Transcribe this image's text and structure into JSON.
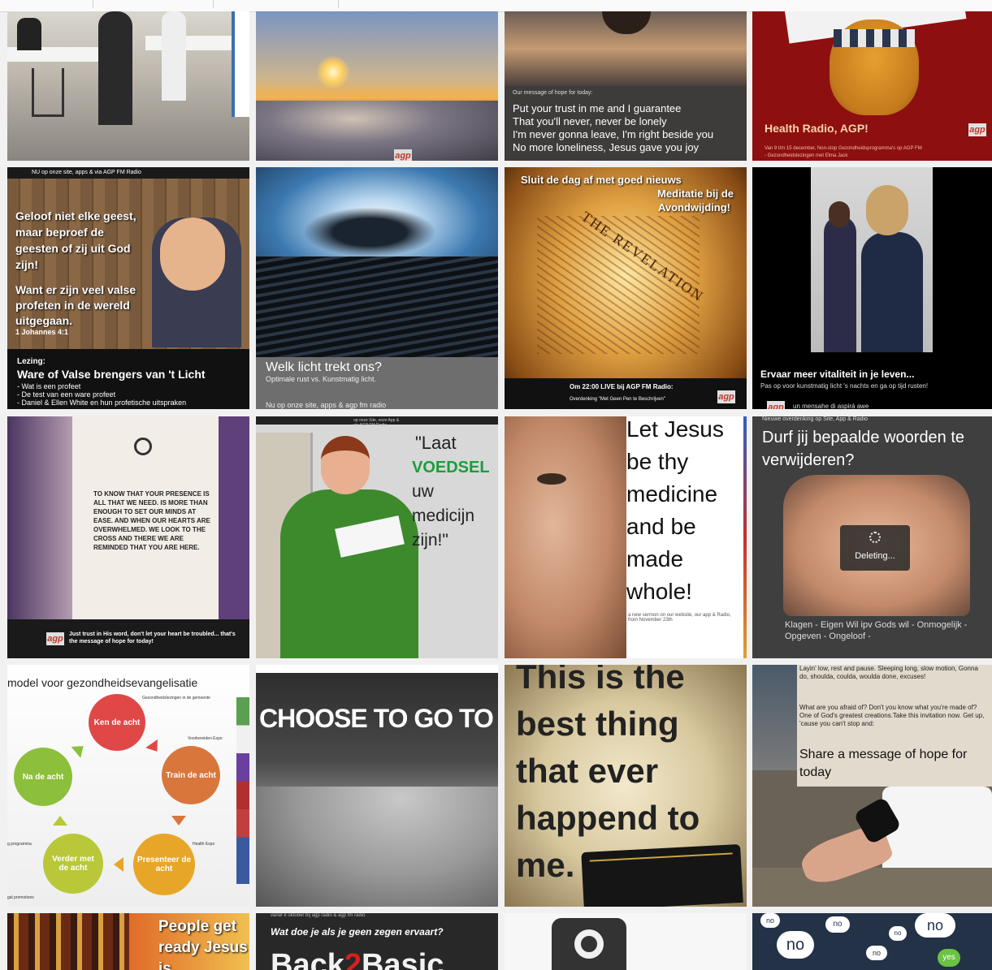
{
  "tiles": {
    "t4_caption": "Our message of hope for today:",
    "t4_lines": [
      "Put your trust in me and I guarantee",
      "That you'll never, never be lonely",
      "I'm never gonna leave, I'm right beside you",
      "No more loneliness, Jesus gave you joy"
    ],
    "t4_brand": "agp",
    "t5_title": "Health Radio, AGP!",
    "t5_sub": "Van 9 t/m 15 december, Non-stop Gezondheidsprogramma's op AGP FM",
    "t5_sub2": "- Gezondheidslezingen met Elma Jack",
    "t6_top": "NU op onze site, apps & via AGP FM Radio",
    "t6_quote": "Geloof niet elke geest, maar beproef de geesten of zij uit God zijn!",
    "t6_quote2": "Want er zijn veel valse profeten in de wereld uitgegaan.",
    "t6_ref": "1 Johannes 4:1",
    "t6_label": "Lezing:",
    "t6_title": "Ware of Valse brengers van 't Licht",
    "t6_b1": "- Wat is een profeet",
    "t6_b2": "- De test van een ware profeet",
    "t6_b3": "- Daniel & Ellen White en hun profetische uitspraken",
    "t7_title": "Welk licht trekt ons?",
    "t7_sub": "Optimale rust vs. Kunstmatig licht.",
    "t7_bottom": "Nu op onze site, apps & agp fm radio",
    "t8_line1": "Sluit de dag af met goed nieuws",
    "t8_line2": "Meditatie bij de",
    "t8_line3": "Avondwijding!",
    "t8_live": "Om 22:00 LIVE bij AGP FM Radio:",
    "t8_sub": "Overdenking \"Met Geen Pen te Beschrijven\"",
    "t9_title": "Ervaar meer vitaliteit in je leven...",
    "t9_sub": "Pas op voor kunstmatig licht 's nachts en ga op tijd rusten!",
    "t9_bottom": "un mensahe di aspirá awe",
    "t10_text": "TO KNOW THAT YOUR PRESENCE IS ALL THAT WE NEED. IS MORE THAN ENOUGH TO SET OUR MINDS AT EASE. AND WHEN OUR HEARTS ARE OVERWHELMED. WE LOOK TO THE CROSS AND THERE WE ARE REMINDED THAT YOU ARE HERE.",
    "t10_footer": "Just trust in His word, don't let your heart be troubled... that's the message of hope for today!",
    "t11_top": "op onze Site, onze App & via AGP FM Radio",
    "t11_q1": "\"Laat",
    "t11_q2": "VOEDSEL",
    "t11_q3": "uw",
    "t11_q4": "medicijn",
    "t11_q5": "zijn!\"",
    "t12_lines": [
      "Let Jesus",
      "be thy",
      "medicine",
      "and be",
      "made",
      "whole!"
    ],
    "t12_small": "a new sermon on our website, our app & Radio, from November 23th",
    "t13_top": "Nieuwe overdenking op Site, App & Radio",
    "t13_title": "Durf jij bepaalde woorden te verwijderen?",
    "t13_deleting": "Deleting...",
    "t13_bottom": "Klagen - Eigen Wil ipv Gods wil - Onmogelijk - Opgeven - Ongeloof -",
    "t14_title": "model voor gezondheidsevangelisatie",
    "t14_c1": "Ken de acht",
    "t14_c2": "Train de acht",
    "t14_c3": "Presenteer de acht",
    "t14_c4": "Verder met de acht",
    "t14_c5": "Na de acht",
    "t14_l1": "Gezondheidslezingen in de gemeente",
    "t14_l2": "Voorbereiden Expo",
    "t14_l3": "Health Expo",
    "t14_l4": "g programma",
    "t14_l5": "gal promotions",
    "t15_text": "CHOOSE TO GO TO T",
    "t16_lines": [
      "This is the",
      "best thing",
      "that ever",
      "happend to",
      "me."
    ],
    "t17_p1": "Layin' low, rest and pause. Sleeping long, slow motion, Gonna do, shoulda, coulda, woulda done, excuses!",
    "t17_p2": "What are you afraid of? Don't you know what you're made of? One of God's greatest creations.Take this invitation now. Get up, 'cause you can't stop and:",
    "t17_title": "Share a message of hope for today",
    "t18_text": "People get ready Jesus is",
    "t19_top": "vanaf 8 oktober bij agp radio & agp fm radio",
    "t19_q": "Wat doe je als je geen zegen ervaart?",
    "t19_big1": "Back",
    "t19_big2": "2",
    "t19_big3": "Basic",
    "t21_no": "no",
    "t21_yes": "yes"
  },
  "colors": {
    "red_brand": "#c0392b",
    "green_voedsel": "#1a9e3a"
  }
}
